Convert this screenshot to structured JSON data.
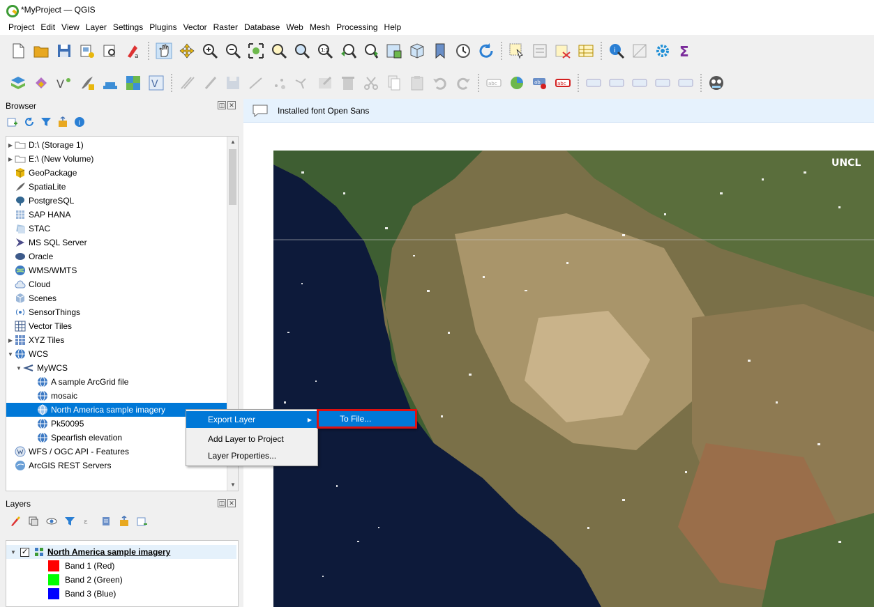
{
  "window": {
    "title": "*MyProject — QGIS"
  },
  "menu": [
    "Project",
    "Edit",
    "View",
    "Layer",
    "Settings",
    "Plugins",
    "Vector",
    "Raster",
    "Database",
    "Web",
    "Mesh",
    "Processing",
    "Help"
  ],
  "browser": {
    "title": "Browser",
    "items": [
      {
        "label": "D:\\ (Storage 1)",
        "icon": "folder-icon",
        "expand": "collapsed"
      },
      {
        "label": "E:\\ (New Volume)",
        "icon": "folder-icon",
        "expand": "collapsed"
      },
      {
        "label": "GeoPackage",
        "icon": "geopackage-icon",
        "expand": "none"
      },
      {
        "label": "SpatiaLite",
        "icon": "spatialite-icon",
        "expand": "none"
      },
      {
        "label": "PostgreSQL",
        "icon": "postgresql-icon",
        "expand": "none"
      },
      {
        "label": "SAP HANA",
        "icon": "sap-hana-icon",
        "expand": "none"
      },
      {
        "label": "STAC",
        "icon": "stac-icon",
        "expand": "none"
      },
      {
        "label": "MS SQL Server",
        "icon": "mssql-icon",
        "expand": "none"
      },
      {
        "label": "Oracle",
        "icon": "oracle-icon",
        "expand": "none"
      },
      {
        "label": "WMS/WMTS",
        "icon": "wms-icon",
        "expand": "none"
      },
      {
        "label": "Cloud",
        "icon": "cloud-icon",
        "expand": "none"
      },
      {
        "label": "Scenes",
        "icon": "scenes-icon",
        "expand": "none"
      },
      {
        "label": "SensorThings",
        "icon": "sensorthings-icon",
        "expand": "none"
      },
      {
        "label": "Vector Tiles",
        "icon": "vector-tiles-icon",
        "expand": "none"
      },
      {
        "label": "XYZ Tiles",
        "icon": "xyz-tiles-icon",
        "expand": "collapsed"
      },
      {
        "label": "WCS",
        "icon": "wcs-icon",
        "expand": "expanded"
      },
      {
        "label": "MyWCS",
        "icon": "connection-icon",
        "expand": "expanded",
        "indent": 1
      },
      {
        "label": "A sample ArcGrid file",
        "icon": "wcs-layer-icon",
        "expand": "none",
        "indent": 2
      },
      {
        "label": "mosaic",
        "icon": "wcs-layer-icon",
        "expand": "none",
        "indent": 2
      },
      {
        "label": "North America sample imagery",
        "icon": "wcs-layer-icon",
        "expand": "none",
        "indent": 2,
        "selected": true
      },
      {
        "label": "Pk50095",
        "icon": "wcs-layer-icon",
        "expand": "none",
        "indent": 2
      },
      {
        "label": "Spearfish elevation",
        "icon": "wcs-layer-icon",
        "expand": "none",
        "indent": 2
      },
      {
        "label": "WFS / OGC API - Features",
        "icon": "wfs-icon",
        "expand": "none"
      },
      {
        "label": "ArcGIS REST Servers",
        "icon": "arcgis-icon",
        "expand": "none"
      }
    ]
  },
  "layers": {
    "title": "Layers",
    "layer_name": "North America sample imagery",
    "bands": [
      {
        "label": "Band 1 (Red)",
        "color": "#ff0000"
      },
      {
        "label": "Band 2 (Green)",
        "color": "#00ff00"
      },
      {
        "label": "Band 3 (Blue)",
        "color": "#0000ff"
      }
    ]
  },
  "message": {
    "text": "Installed font Open Sans"
  },
  "context_menu": {
    "items": [
      "Export Layer",
      "Add Layer to Project",
      "Layer Properties..."
    ],
    "submenu": [
      "To File..."
    ]
  },
  "map_label": "UNCL",
  "colors": {
    "selection": "#0078d7",
    "highlight_box": "#e01010",
    "message_bg": "#e6f2fd"
  }
}
